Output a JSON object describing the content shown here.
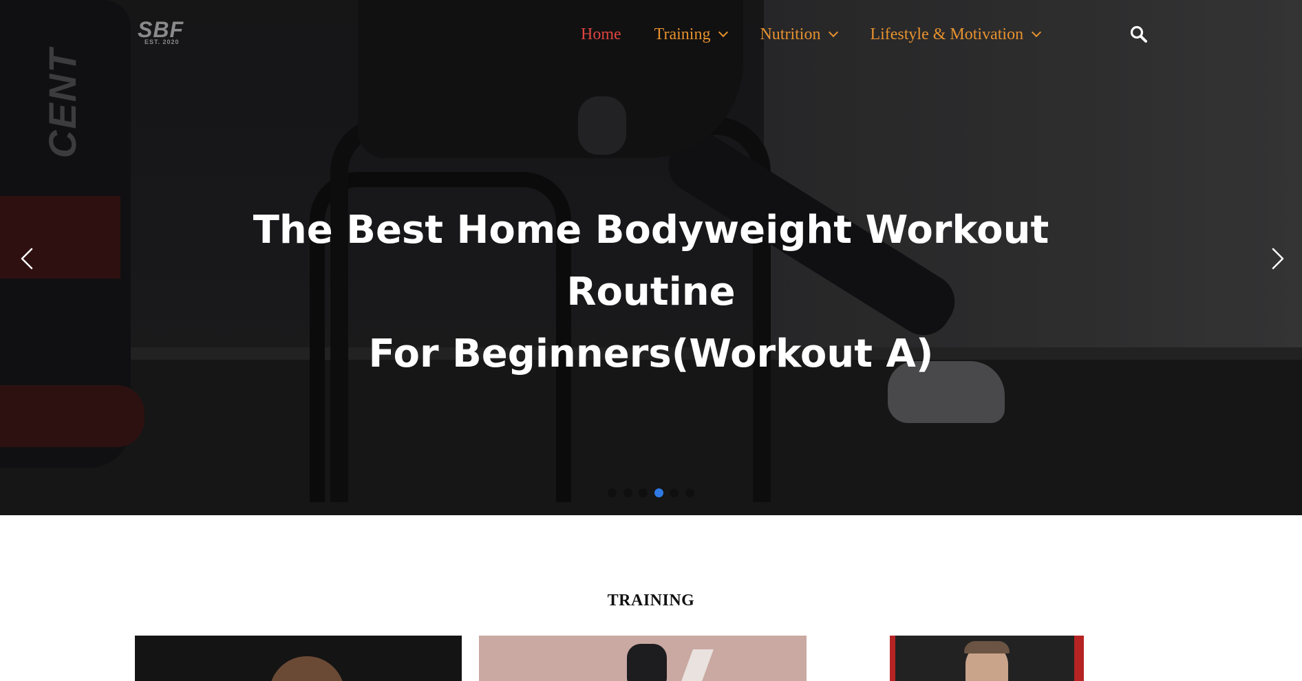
{
  "brand": {
    "logo_text": "SBF",
    "logo_subtext": "EST. 2020",
    "accent_color": "#e8922e",
    "active_color": "#e0453f",
    "dot_active_color": "#2f7ae5"
  },
  "nav": {
    "items": [
      {
        "label": "Home",
        "active": true,
        "has_dropdown": false
      },
      {
        "label": "Training",
        "active": false,
        "has_dropdown": true
      },
      {
        "label": "Nutrition",
        "active": false,
        "has_dropdown": true
      },
      {
        "label": "Lifestyle & Motivation",
        "active": false,
        "has_dropdown": true
      }
    ],
    "search_icon": "search-icon"
  },
  "hero": {
    "title_line1": "The Best Home Bodyweight Workout Routine",
    "title_line2": "For Beginners(Workout A)",
    "bag_text": "CENT",
    "prev_icon": "chevron-left-icon",
    "next_icon": "chevron-right-icon",
    "slide_count": 6,
    "active_slide": 4
  },
  "section": {
    "title": "TRAINING"
  }
}
